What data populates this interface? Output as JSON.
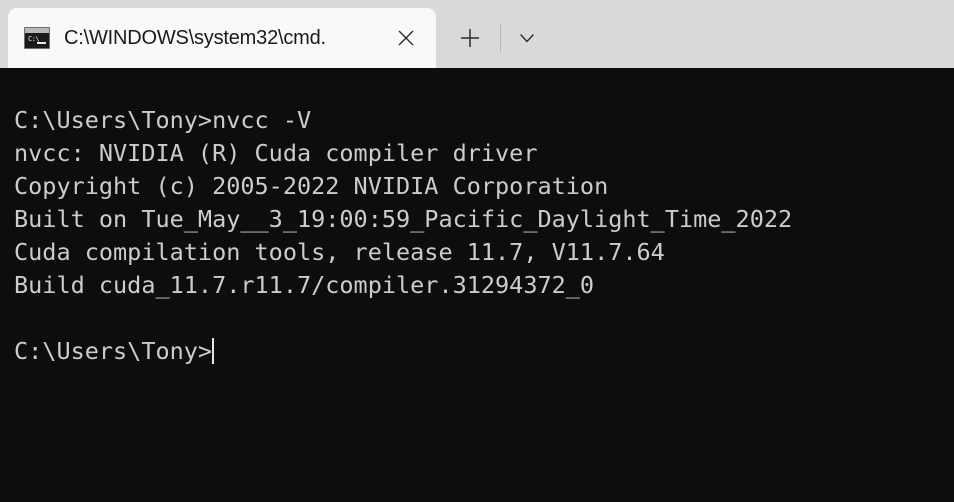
{
  "window": {
    "app": "Windows Terminal",
    "titlebar_color": "#d9d9d9",
    "active_tab_color": "#f9f9f9"
  },
  "tabbar": {
    "tabs": [
      {
        "title": "C:\\WINDOWS\\system32\\cmd.",
        "icon": "cmd-console-icon",
        "icon_prompt_text": "C:\\",
        "close_label": "✕",
        "active": true
      }
    ],
    "new_tab_label": "+",
    "dropdown_label": "⌄"
  },
  "console": {
    "background_color": "#0d0d0d",
    "text_color": "#cccccc",
    "lines": [
      "C:\\Users\\Tony>nvcc -V",
      "nvcc: NVIDIA (R) Cuda compiler driver",
      "Copyright (c) 2005-2022 NVIDIA Corporation",
      "Built on Tue_May__3_19:00:59_Pacific_Daylight_Time_2022",
      "Cuda compilation tools, release 11.7, V11.7.64",
      "Build cuda_11.7.r11.7/compiler.31294372_0",
      "",
      "C:\\Users\\Tony>"
    ],
    "prompt": "C:\\Users\\Tony>",
    "command": "nvcc -V",
    "cursor_visible": true
  }
}
